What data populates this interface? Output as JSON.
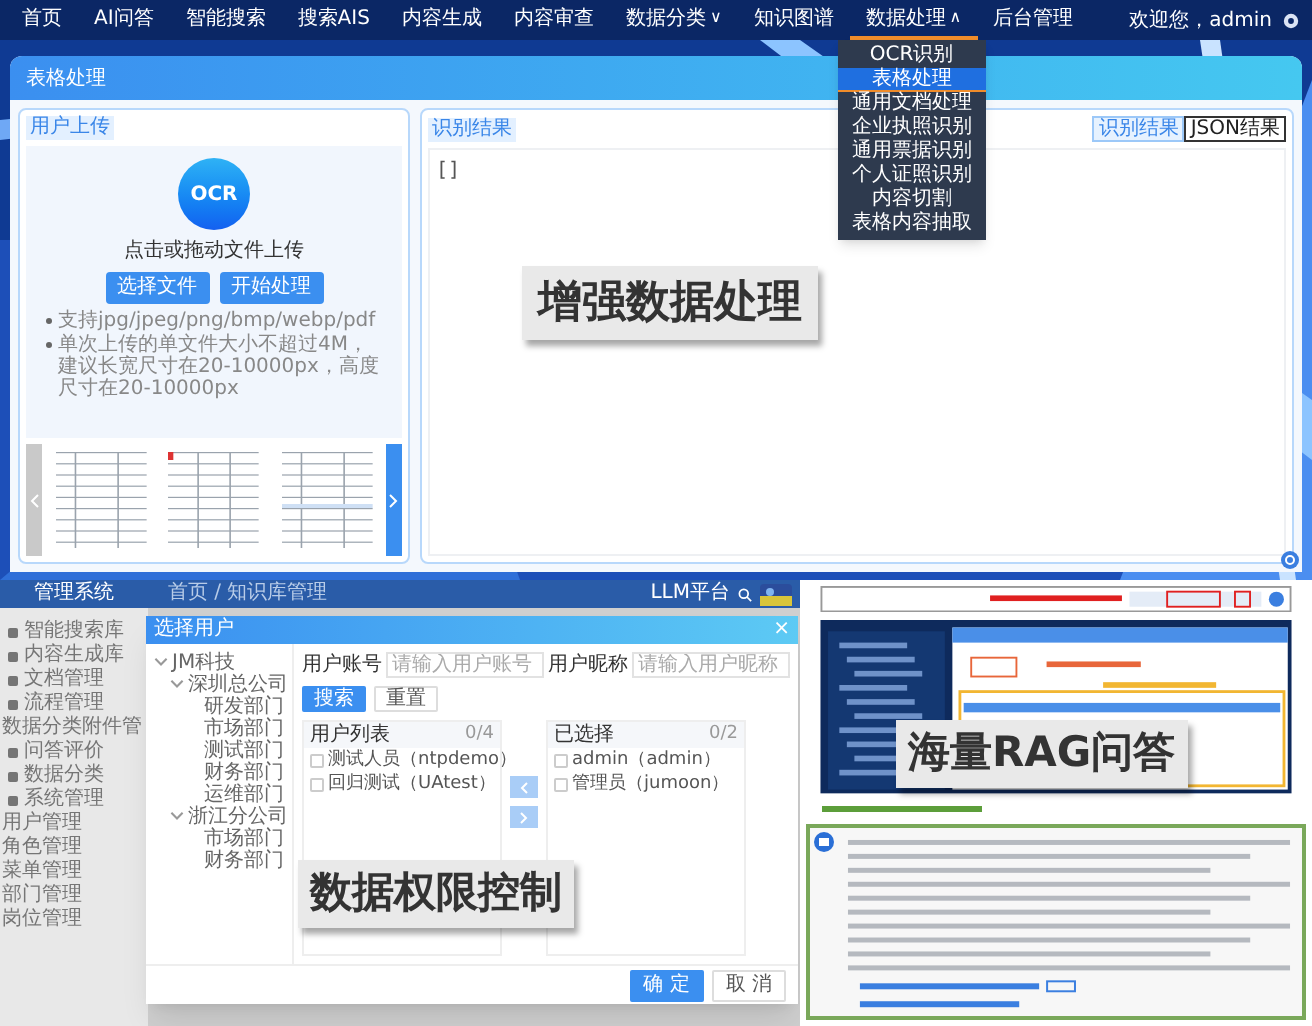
{
  "header": {
    "nav": [
      {
        "label": "首页",
        "selected": false
      },
      {
        "label": "AI问答",
        "selected": false
      },
      {
        "label": "智能搜索",
        "selected": false
      },
      {
        "label": "搜索AIS",
        "selected": false
      },
      {
        "label": "内容生成",
        "selected": false
      },
      {
        "label": "内容审查",
        "selected": false
      },
      {
        "label": "数据分类",
        "selected": false,
        "caret": "∨"
      },
      {
        "label": "知识图谱",
        "selected": false
      },
      {
        "label": "数据处理",
        "selected": true,
        "caret": "∧",
        "menu": [
          {
            "label": "OCR识别",
            "selected": false
          },
          {
            "label": "表格处理",
            "selected": true
          },
          {
            "label": "通用文档处理",
            "selected": false
          },
          {
            "label": "企业执照识别",
            "selected": false
          },
          {
            "label": "通用票据识别",
            "selected": false
          },
          {
            "label": "个人证照识别",
            "selected": false
          },
          {
            "label": "内容切割",
            "selected": false
          },
          {
            "label": "表格内容抽取",
            "selected": false
          }
        ]
      },
      {
        "label": "后台管理",
        "selected": false
      }
    ],
    "user": "欢迎您，admin"
  },
  "page": {
    "title": "表格处理",
    "upload": {
      "tag": "用户上传",
      "logo": "OCR",
      "prompt": "点击或拖动文件上传",
      "buttons": [
        "选择文件",
        "开始处理"
      ],
      "notes": [
        "支持jpg/jpeg/png/bmp/webp/pdf",
        "单次上传的单文件大小不超过4M，建议长宽尺寸在20-10000px，高度尺寸在20-10000px"
      ]
    },
    "result": {
      "tag": "识别结果",
      "tabs": [
        {
          "label": "识别结果",
          "selected": false
        },
        {
          "label": "JSON结果",
          "selected": true
        }
      ],
      "content": "[]"
    },
    "caption": "增强数据处理"
  },
  "permissions": {
    "app_title": "管理系统",
    "breadcrumb": "首页 / 知识库管理",
    "platform": "LLM平台",
    "sidebar": [
      {
        "label": "智能搜索库"
      },
      {
        "label": "内容生成库"
      },
      {
        "label": "文档管理"
      },
      {
        "label": "流程管理",
        "children": [
          {
            "label": "数据分类附件管"
          }
        ]
      },
      {
        "label": "问答评价"
      },
      {
        "label": "数据分类"
      },
      {
        "label": "系统管理",
        "children": [
          {
            "label": "用户管理"
          },
          {
            "label": "角色管理"
          },
          {
            "label": "菜单管理"
          },
          {
            "label": "部门管理"
          },
          {
            "label": "岗位管理"
          }
        ]
      }
    ],
    "dialog": {
      "title": "选择用户",
      "close": "×",
      "tree": [
        {
          "label": "JM科技",
          "expanded": true,
          "children": [
            {
              "label": "深圳总公司",
              "expanded": true,
              "children": [
                {
                  "label": "研发部门"
                },
                {
                  "label": "市场部门"
                },
                {
                  "label": "测试部门"
                },
                {
                  "label": "财务部门"
                },
                {
                  "label": "运维部门"
                }
              ]
            },
            {
              "label": "浙江分公司",
              "expanded": true,
              "children": [
                {
                  "label": "市场部门"
                },
                {
                  "label": "财务部门"
                }
              ]
            }
          ]
        }
      ],
      "filters": [
        {
          "label": "用户账号",
          "placeholder": "请输入用户账号"
        },
        {
          "label": "用户昵称",
          "placeholder": "请输入用户昵称"
        }
      ],
      "actions": [
        {
          "label": "搜索",
          "kind": "primary"
        },
        {
          "label": "重置",
          "kind": "plain"
        }
      ],
      "lists": [
        {
          "title": "用户列表",
          "count": "0/4",
          "items": [
            {
              "label": "测试人员（ntpdemo）",
              "checked": false
            },
            {
              "label": "回归测试（UAtest）",
              "checked": false
            }
          ]
        },
        {
          "title": "已选择",
          "count": "0/2",
          "items": [
            {
              "label": "admin（admin）",
              "checked": false
            },
            {
              "label": "管理员（jumoon）",
              "checked": false
            }
          ]
        }
      ],
      "footer": [
        {
          "label": "确 定",
          "kind": "primary"
        },
        {
          "label": "取 消",
          "kind": "plain"
        }
      ]
    },
    "caption": "数据权限控制"
  },
  "rag": {
    "caption": "海量RAG问答"
  }
}
